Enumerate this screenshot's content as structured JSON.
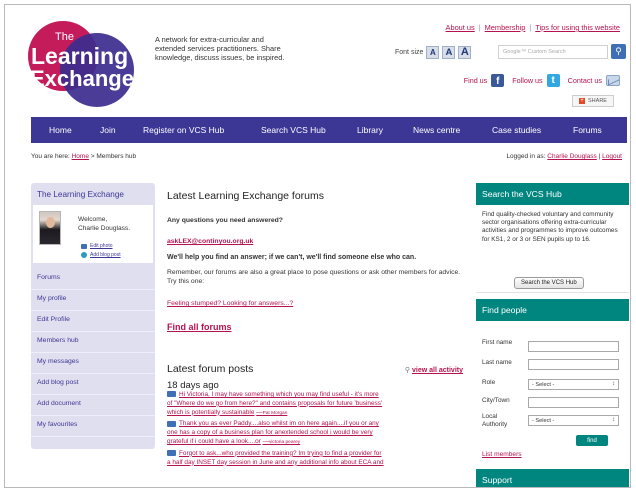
{
  "brand": {
    "logo_line1": "The",
    "logo_line2": "Learning",
    "logo_line3": "Exchange",
    "tagline": "A network for extra-curricular and extended services practitioners. Share knowledge, discuss issues, be inspired.",
    "colors": {
      "magenta": "#b5134f",
      "nav": "#3c3695",
      "teal": "#00867f",
      "logo_circle_blue": "#3c2c8e",
      "logo_circle_pink": "#c41b5b"
    }
  },
  "header": {
    "links": [
      "About us",
      "Membership",
      "Tips for using this website"
    ],
    "fontsize_label": "Font size",
    "fontsize_buttons": [
      "A",
      "A",
      "A"
    ],
    "search_placeholder": "Google™ Custom Search",
    "search_icon": "search-icon",
    "find_us": "Find us",
    "follow_us": "Follow us",
    "contact_us": "Contact us",
    "share_label": "SHARE"
  },
  "nav": [
    "Home",
    "Join",
    "Register on VCS Hub",
    "Search VCS Hub",
    "Library",
    "News centre",
    "Case studies",
    "Forums"
  ],
  "breadcrumb": {
    "prefix": "You are here:",
    "home": "Home",
    "separator": " > ",
    "current": "Members hub"
  },
  "session": {
    "logged_prefix": "Logged in as:",
    "user": "Charlie Douglass",
    "separator": " | ",
    "logout": "Logout"
  },
  "sidebar": {
    "title": "The Learning Exchange",
    "welcome_line1": "Welcome,",
    "welcome_line2": "Charlie Douglass.",
    "edit_photo": "Edit photo",
    "add_blog_post": "Add blog post",
    "items": [
      "Forums",
      "My profile",
      "Edit Profile",
      "Members hub",
      "My messages",
      "Add blog post",
      "Add document",
      "My favourites"
    ]
  },
  "main": {
    "forums_heading": "Latest Learning Exchange forums",
    "questions": "Any questions you need answered?",
    "email": "askLEX@continyou.org.uk",
    "help_text": "We'll help you find an answer; if we can't, we'll find someone else who can.",
    "remember_text": "Remember, our forums are also a great place to pose questions or ask other members for advice. Try this one:",
    "feeling_link": "Feeling stumped? Looking for answers...?",
    "find_all": "Find all forums",
    "posts_heading": "Latest forum posts",
    "view_all": "view all activity",
    "days_ago": "18 days ago",
    "posts": [
      {
        "l1": "Hi Victoria, I may have something which you may find useful - it's more",
        "l2": "of \"Where do we go from here?\" and contains proposals for future 'business'",
        "l3": "which is potentially sustainable",
        "author": "Pat Morgan"
      },
      {
        "l1": "Thank you as ever Paddy....also whilst im on here again....if you or any",
        "l2": "one has a copy of a business plan for anextended school i would be very",
        "l3": "grateful if i could have a look....or",
        "author": "victoria pearey"
      },
      {
        "l1": "Forgot to ask...who provided the training? Im trying to find a provider for",
        "l2": "a half day INSET day session in June and any additional info about ECA and",
        "l3": "",
        "author": ""
      }
    ]
  },
  "vcs_box": {
    "title": "Search the VCS Hub",
    "text": "Find quality-checked voluntary and community sector organisations offering extra-curricular activities and programmes to improve outcomes for KS1, 2 or 3 or SEN pupils up to 16.",
    "button": "Search the VCS Hub"
  },
  "people_box": {
    "title": "Find people",
    "first_name": "First name",
    "last_name": "Last name",
    "role": "Role",
    "role_value": "- Select -",
    "city": "City/Town",
    "authority": "Local Authority",
    "authority_value": "- Select -",
    "find_button": "find",
    "list_members": "List members"
  },
  "support_box": {
    "title": "Support"
  }
}
